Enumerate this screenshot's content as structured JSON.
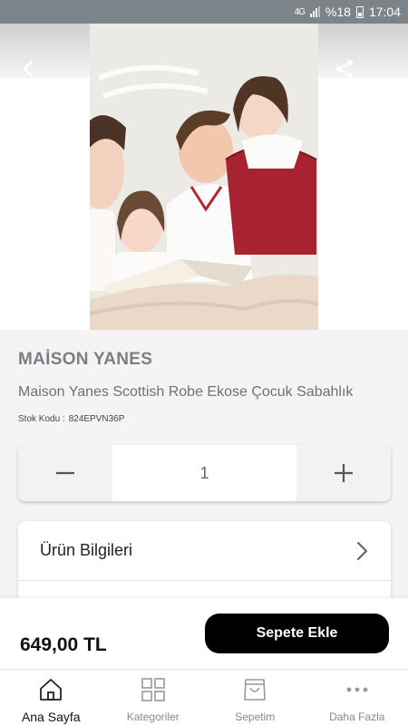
{
  "status_bar": {
    "network": "4G",
    "battery": "%18",
    "time": "17:04"
  },
  "product": {
    "brand": "MAİSON YANES",
    "title": "Maison Yanes Scottish Robe Ekose Çocuk Sabahlık",
    "sku_label": "Stok Kodu :",
    "sku_value": "824EPVN36P",
    "image_alt": "Aile pijama fotoğrafı"
  },
  "quantity": {
    "value": "1",
    "decrement_icon": "minus-icon",
    "increment_icon": "plus-icon"
  },
  "info": {
    "rows": [
      {
        "label": "Ürün Bilgileri",
        "icon": "chevron-right-icon"
      }
    ]
  },
  "purchase": {
    "price": "649,00 TL",
    "button_label": "Sepete Ekle"
  },
  "tabs": [
    {
      "label": "Ana Sayfa",
      "icon": "home-icon",
      "active": true
    },
    {
      "label": "Kategoriler",
      "icon": "grid-icon",
      "active": false
    },
    {
      "label": "Sepetim",
      "icon": "shopping-bag-icon",
      "active": false
    },
    {
      "label": "Daha Fazla",
      "icon": "more-icon",
      "active": false
    }
  ],
  "colors": {
    "accent": "#000000",
    "brand_text": "#7a7f84",
    "status_bar": "#7d8489"
  }
}
